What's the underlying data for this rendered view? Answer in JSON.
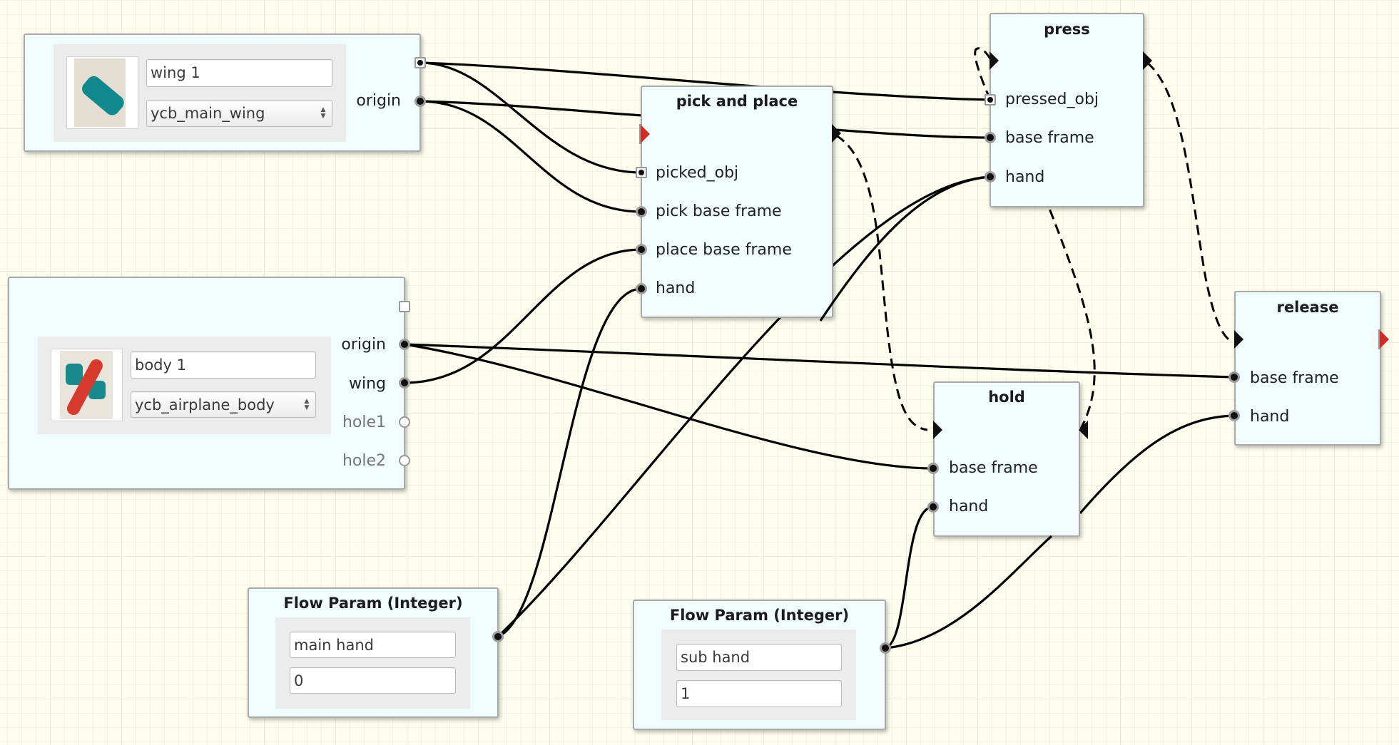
{
  "canvas": {
    "background": "#fefeee",
    "node_fill": "#f1fdfc",
    "flow_in_start_color": "#d22a26"
  },
  "nodes": {
    "wing": {
      "type": "object",
      "name_value": "wing 1",
      "model_selected": "ycb_main_wing",
      "thumbnail_icon": "teal-wing-part-image",
      "ports": [
        {
          "label": "",
          "kind": "square-connected"
        },
        {
          "label": "origin",
          "kind": "connected"
        }
      ]
    },
    "body": {
      "type": "object",
      "name_value": "body 1",
      "model_selected": "ycb_airplane_body",
      "thumbnail_icon": "red-airplane-body-image",
      "ports": [
        {
          "label": "",
          "kind": "square-empty"
        },
        {
          "label": "origin",
          "kind": "connected"
        },
        {
          "label": "wing",
          "kind": "connected"
        },
        {
          "label": "hole1",
          "kind": "open"
        },
        {
          "label": "hole2",
          "kind": "open"
        }
      ]
    },
    "pick_and_place": {
      "title": "pick and place",
      "inputs": [
        "picked_obj",
        "pick base frame",
        "place base frame",
        "hand"
      ]
    },
    "press": {
      "title": "press",
      "inputs": [
        "pressed_obj",
        "base frame",
        "hand"
      ]
    },
    "hold": {
      "title": "hold",
      "inputs": [
        "base frame",
        "hand"
      ]
    },
    "release": {
      "title": "release",
      "inputs": [
        "base frame",
        "hand"
      ]
    },
    "flow_param_1": {
      "title": "Flow Param (Integer)",
      "name_value": "main hand",
      "int_value": "0"
    },
    "flow_param_2": {
      "title": "Flow Param (Integer)",
      "name_value": "sub hand",
      "int_value": "1"
    }
  },
  "connections": {
    "data": [
      {
        "from": "wing.pose",
        "to": "press.pressed_obj"
      },
      {
        "from": "wing.pose",
        "to": "pick_and_place.picked_obj"
      },
      {
        "from": "wing.origin",
        "to": "pick_and_place.pick base frame"
      },
      {
        "from": "wing.origin",
        "to": "press.base frame"
      },
      {
        "from": "body.origin",
        "to": "release.base frame"
      },
      {
        "from": "body.origin",
        "to": "hold.base frame"
      },
      {
        "from": "body.wing",
        "to": "pick_and_place.place base frame"
      },
      {
        "from": "flow_param_1",
        "to": "pick_and_place.hand"
      },
      {
        "from": "flow_param_1",
        "to": "press.hand"
      },
      {
        "from": "flow_param_2",
        "to": "hold.hand"
      },
      {
        "from": "flow_param_2",
        "to": "release.hand"
      }
    ],
    "flow": [
      {
        "from": "pick_and_place",
        "to": "hold"
      },
      {
        "from": "hold",
        "to": "press"
      },
      {
        "from": "press",
        "to": "release"
      }
    ]
  }
}
